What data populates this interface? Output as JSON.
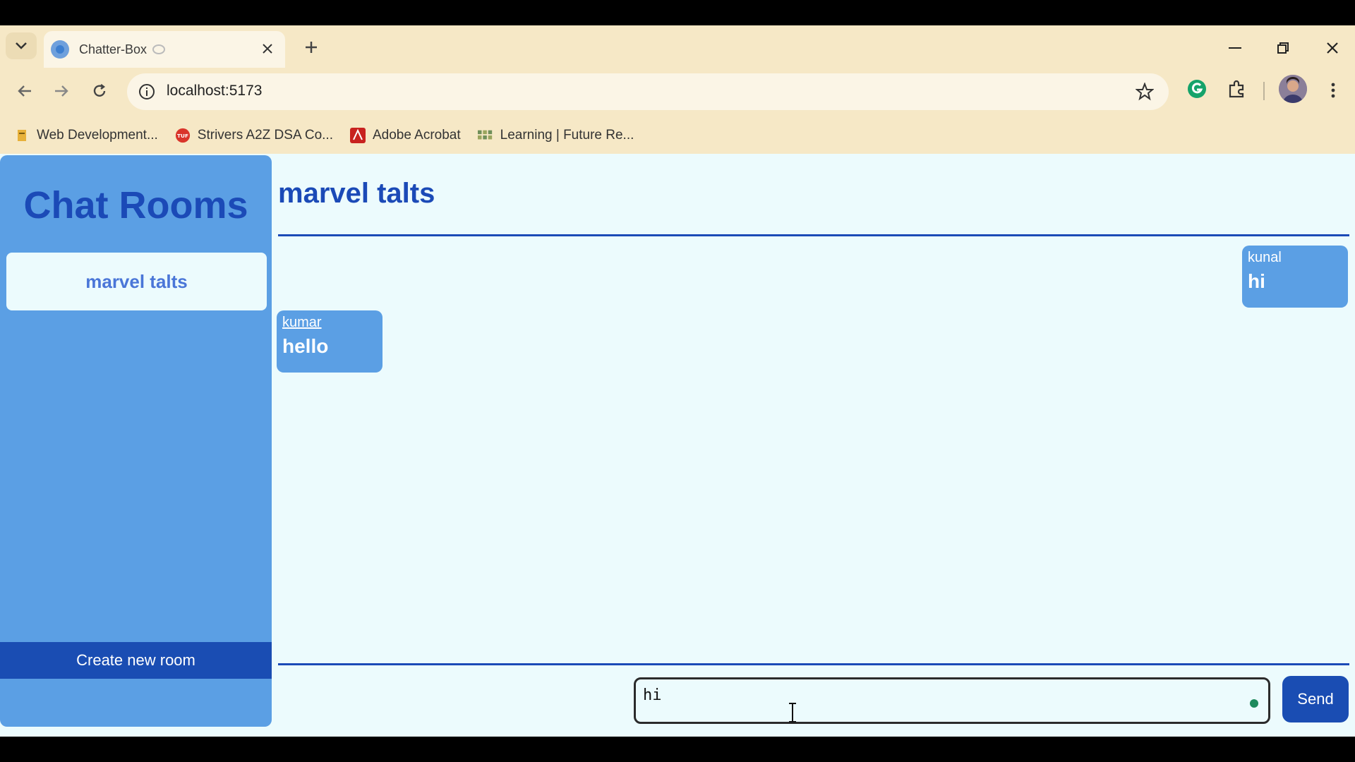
{
  "browser": {
    "tab": {
      "title": "Chatter-Box"
    },
    "address": {
      "url": "localhost:5173"
    },
    "bookmarks": [
      {
        "label": "Web Development..."
      },
      {
        "label": "Strivers A2Z DSA Co..."
      },
      {
        "label": "Adobe Acrobat"
      },
      {
        "label": "Learning | Future Re..."
      }
    ],
    "icons": {
      "tab_list": "chevron-down-icon",
      "new_tab": "plus-icon",
      "close": "close-icon",
      "back": "arrow-left-icon",
      "forward": "arrow-right-icon",
      "reload": "reload-icon",
      "info": "info-icon",
      "star": "star-icon",
      "grammarly": "grammarly-icon",
      "extensions": "puzzle-icon",
      "menu": "kebab-icon"
    }
  },
  "sidebar": {
    "title": "Chat Rooms",
    "rooms": [
      {
        "label": "marvel talts"
      }
    ],
    "create_label": "Create new room"
  },
  "main": {
    "room_title": "marvel talts",
    "messages": [
      {
        "user": "kunal",
        "text": "hi",
        "side": "right"
      },
      {
        "user": "kumar",
        "text": "hello",
        "side": "left"
      }
    ],
    "composer": {
      "value": "hi"
    },
    "send_label": "Send"
  },
  "colors": {
    "sidebar": "#5b9fe4",
    "accent": "#1a4db3",
    "page_bg": "#ecfbfd",
    "chrome_bg": "#f6e8c6"
  }
}
